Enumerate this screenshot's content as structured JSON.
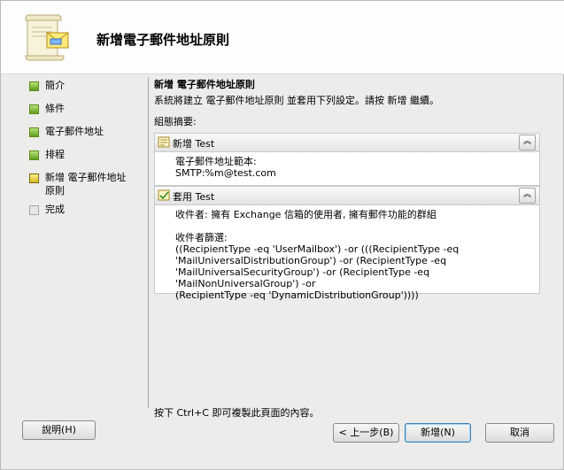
{
  "window": {
    "title": "新增電子郵件地址原則"
  },
  "steps": [
    {
      "label": "簡介",
      "state": "done"
    },
    {
      "label": "條件",
      "state": "done"
    },
    {
      "label": "電子郵件地址",
      "state": "done"
    },
    {
      "label": "排程",
      "state": "done"
    },
    {
      "label": "新增 電子郵件地址原則",
      "state": "current"
    },
    {
      "label": "完成",
      "state": "pending"
    }
  ],
  "content": {
    "title": "新增 電子郵件地址原則",
    "description": "系統將建立 電子郵件地址原則 並套用下列設定。請按 新增 繼續。",
    "summary_label": "組態摘要:",
    "panels": [
      {
        "title": "新增 Test",
        "lines": [
          "電子郵件地址範本:",
          "SMTP:%m@test.com"
        ]
      },
      {
        "title": "套用 Test",
        "lines": [
          "收件者: 擁有 Exchange 信箱的使用者, 擁有郵件功能的群組",
          "",
          "收件者篩選:",
          "((RecipientType -eq 'UserMailbox') -or (((RecipientType -eq",
          "'MailUniversalDistributionGroup') -or (RecipientType -eq",
          "'MailUniversalSecurityGroup') -or (RecipientType -eq 'MailNonUniversalGroup') -or",
          "(RecipientType -eq 'DynamicDistributionGroup'))))"
        ]
      }
    ],
    "copy_note": "按下 Ctrl+C 即可複製此頁面的內容。"
  },
  "buttons": {
    "help": "說明(H)",
    "back": "< 上一步(B)",
    "add": "新增(N)",
    "cancel": "取消"
  },
  "icons": {
    "wizard": "scroll-envelope-icon",
    "collapse": "chevron-double-up-icon"
  }
}
